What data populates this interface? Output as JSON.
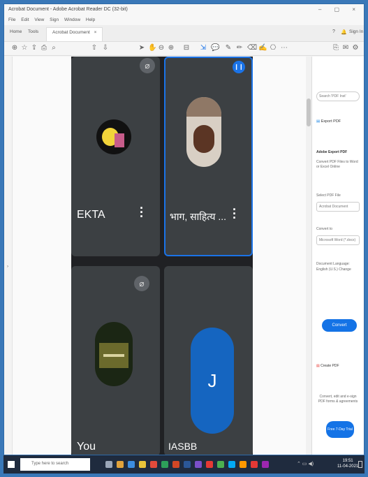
{
  "window": {
    "title": "Acrobat Document - Adobe Acrobat Reader DC (32-bit)",
    "controls": "–  ▢  ×"
  },
  "menubar": [
    "File",
    "Edit",
    "View",
    "Sign",
    "Window",
    "Help"
  ],
  "tabs": {
    "home": "Home",
    "tools": "Tools",
    "document": "Acrobat Document",
    "close": "×",
    "signin": "Sign In"
  },
  "participants": [
    {
      "name": "EKTA",
      "avatar": "photo"
    },
    {
      "name": "भाग, साहित्य ...",
      "avatar": "photo",
      "speaking": true
    },
    {
      "name": "You",
      "avatar": "photo"
    },
    {
      "name": "IASBB",
      "avatar": "letter",
      "letter": "J"
    }
  ],
  "sidepanel": {
    "search_placeholder": "Search 'PDF Inst'",
    "export_pdf": "Export PDF",
    "heading": "Adobe Export PDF",
    "desc": "Convert PDF Files to Word or Excel Online",
    "select_file": "Select PDF File",
    "file_value": "Acrobat Document",
    "convert_to": "Convert to",
    "format_value": "Microsoft Word (*.docx)",
    "language_label": "Document Language:",
    "language_value": "English (U.S.) Change",
    "convert_btn": "Convert",
    "create_pdf": "Create PDF",
    "promo": "Convert, edit and e-sign PDF forms & agreements",
    "trial_btn": "Free 7-Day Trial"
  },
  "taskbar": {
    "search_placeholder": "Type here to search",
    "time": "19:51",
    "date": "11-04-2021"
  }
}
